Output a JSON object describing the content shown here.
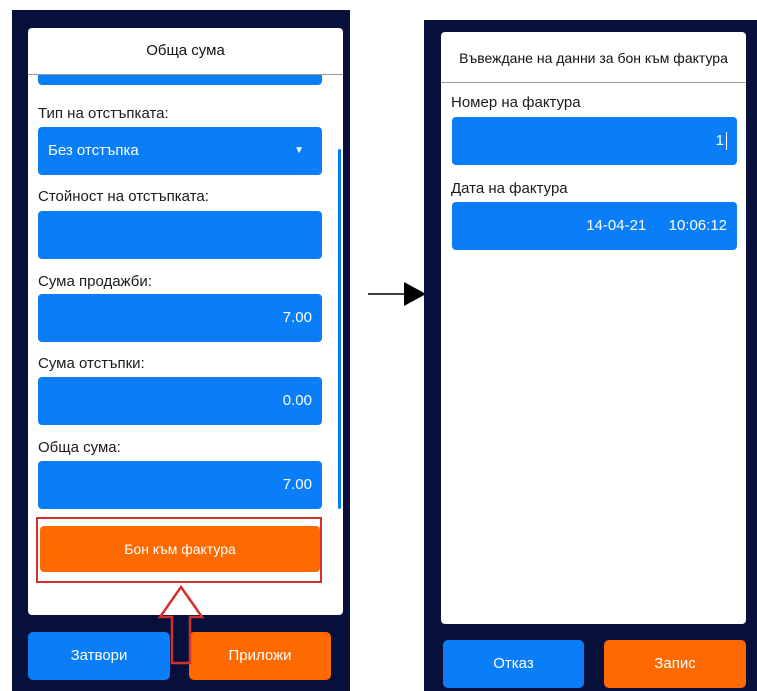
{
  "left_screen": {
    "title": "Обща сума",
    "discount_type_label": "Тип на отстъпката:",
    "discount_type_value": "Без отстъпка",
    "discount_value_label": "Стойност на отстъпката:",
    "discount_value": "",
    "sales_total_label": "Сума продажби:",
    "sales_total_value": "7.00",
    "discount_total_label": "Сума отстъпки:",
    "discount_total_value": "0.00",
    "grand_total_label": "Обща сума:",
    "grand_total_value": "7.00",
    "invoice_button": "Бон към фактура",
    "close_button": "Затвори",
    "apply_button": "Приложи"
  },
  "right_screen": {
    "title": "Въвеждане на данни за бон към фактура",
    "invoice_number_label": "Номер на фактура",
    "invoice_number_value": "1",
    "invoice_date_label": "Дата на фактура",
    "invoice_date_value": "14-04-21",
    "invoice_time_value": "10:06:12",
    "cancel_button": "Отказ",
    "save_button": "Запис"
  },
  "colors": {
    "accent_blue": "#0a7df8",
    "accent_orange": "#ff6a00",
    "phone_background": "#07103a",
    "highlight_red": "#d32f2f"
  }
}
